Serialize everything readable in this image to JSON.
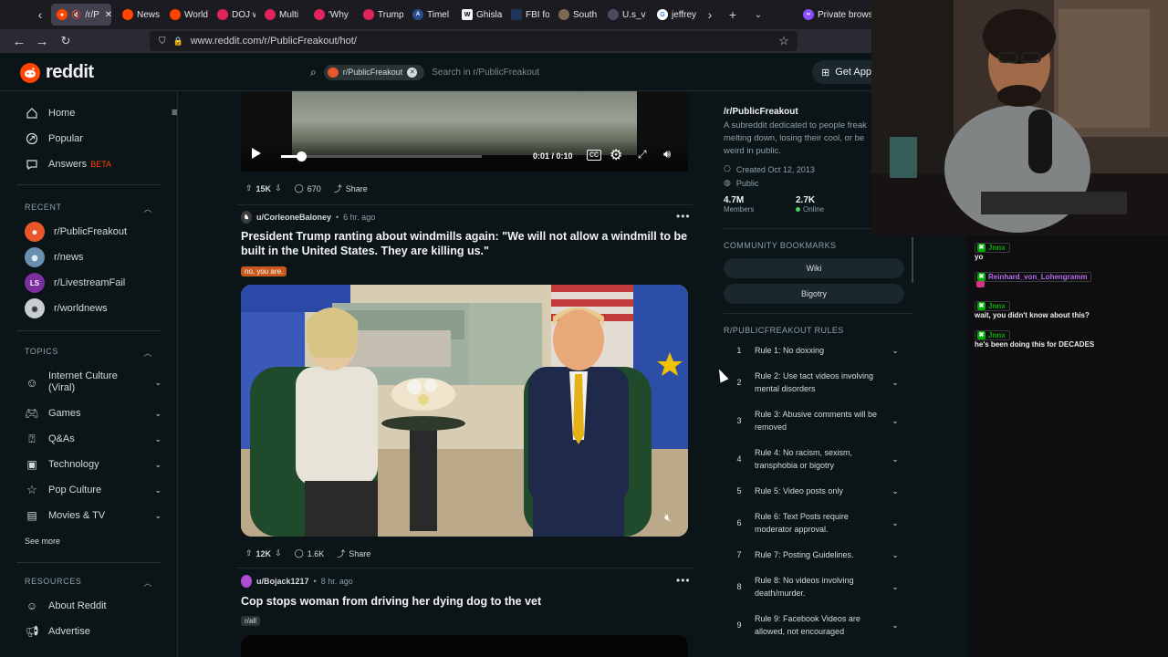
{
  "browser": {
    "tabs": [
      {
        "label": "/r/P",
        "active": true
      },
      {
        "label": "News"
      },
      {
        "label": "World"
      },
      {
        "label": "DOJ w"
      },
      {
        "label": "Multi"
      },
      {
        "label": "'Why"
      },
      {
        "label": "Trump"
      },
      {
        "label": "Timel"
      },
      {
        "label": "Ghisla"
      },
      {
        "label": "FBI fo"
      },
      {
        "label": "South"
      },
      {
        "label": "U.s_v"
      },
      {
        "label": "jeffrey"
      }
    ],
    "private_label": "Private browsing",
    "url": "www.reddit.com/r/PublicFreakout/hot/"
  },
  "header": {
    "logo_text": "reddit",
    "search_chip": "r/PublicFreakout",
    "search_placeholder": "Search in r/PublicFreakout",
    "get_app": "Get App"
  },
  "sidebar": {
    "nav": [
      {
        "label": "Home",
        "icon": "home-icon"
      },
      {
        "label": "Popular",
        "icon": "popular-icon"
      },
      {
        "label": "Answers",
        "icon": "answers-icon",
        "badge": "BETA"
      }
    ],
    "recent_title": "RECENT",
    "recent": [
      {
        "label": "r/PublicFreakout",
        "color": "#e8572a"
      },
      {
        "label": "r/news",
        "color": "#6b8fb0"
      },
      {
        "label": "r/LivestreamFail",
        "color": "#7b2f9e"
      },
      {
        "label": "r/worldnews",
        "color": "#c7cdd0"
      }
    ],
    "topics_title": "TOPICS",
    "topics": [
      {
        "label": "Internet Culture (Viral)",
        "icon": "smiley-icon"
      },
      {
        "label": "Games",
        "icon": "gamepad-icon"
      },
      {
        "label": "Q&As",
        "icon": "qa-icon"
      },
      {
        "label": "Technology",
        "icon": "chip-icon"
      },
      {
        "label": "Pop Culture",
        "icon": "star-icon"
      },
      {
        "label": "Movies & TV",
        "icon": "film-icon"
      }
    ],
    "see_more": "See more",
    "resources_title": "RESOURCES",
    "resources": [
      {
        "label": "About Reddit",
        "icon": "reddit-icon"
      },
      {
        "label": "Advertise",
        "icon": "megaphone-icon"
      }
    ]
  },
  "player": {
    "time": "0:01 / 0:10",
    "progress": 0.1
  },
  "posts": [
    {
      "upvotes": "15K",
      "comments": "670",
      "share": "Share"
    },
    {
      "author": "u/CorleoneBaloney",
      "time": "6 hr. ago",
      "title": "President Trump ranting about windmills again: \"We will not allow a windmill to be built in the United States. They are killing us.\"",
      "flair": "no, you are.",
      "upvotes": "12K",
      "comments": "1.6K",
      "share": "Share"
    },
    {
      "author": "u/Bojack1217",
      "time": "8 hr. ago",
      "title": "Cop stops woman from driving her dying dog to the vet",
      "flair": "r/all"
    }
  ],
  "community": {
    "name": "/r/PublicFreakout",
    "description": "A subreddit dedicated to people freak melting down, losing their cool, or be weird in public.",
    "created": "Created Oct 12, 2013",
    "visibility": "Public",
    "members_value": "4.7M",
    "members_label": "Members",
    "online_value": "2.7K",
    "online_label": "Online",
    "bookmarks_title": "COMMUNITY BOOKMARKS",
    "bookmarks": [
      "Wiki",
      "Bigotry"
    ],
    "rules_title": "R/PUBLICFREAKOUT RULES",
    "rules": [
      {
        "num": "1",
        "text": "Rule 1: No doxxing"
      },
      {
        "num": "2",
        "text": "Rule 2: Use tact videos involving mental disorders"
      },
      {
        "num": "3",
        "text": "Rule 3: Abusive comments will be removed"
      },
      {
        "num": "4",
        "text": "Rule 4: No racism, sexism, transphobia or bigotry"
      },
      {
        "num": "5",
        "text": "Rule 5: Video posts only"
      },
      {
        "num": "6",
        "text": "Rule 6: Text Posts require moderator approval."
      },
      {
        "num": "7",
        "text": "Rule 7: Posting Guidelines."
      },
      {
        "num": "8",
        "text": "Rule 8: No videos involving death/murder."
      },
      {
        "num": "9",
        "text": "Rule 9: Facebook Videos are allowed, not encouraged"
      }
    ]
  },
  "chat": [
    {
      "user": "Jnnx",
      "color": "#00ad03",
      "message": "yo"
    },
    {
      "user": "Reinhard_von_Lohengramm",
      "color": "#b56cf0",
      "message": ""
    },
    {
      "user": "Jnnx",
      "color": "#00ad03",
      "message": "wait, you didn't know about this?"
    },
    {
      "user": "Jnnx",
      "color": "#00ad03",
      "message": "he's been doing this for DECADES"
    }
  ],
  "colors": {
    "reddit_orange": "#ff4500",
    "background": "#0b1416",
    "online_green": "#46d160"
  }
}
